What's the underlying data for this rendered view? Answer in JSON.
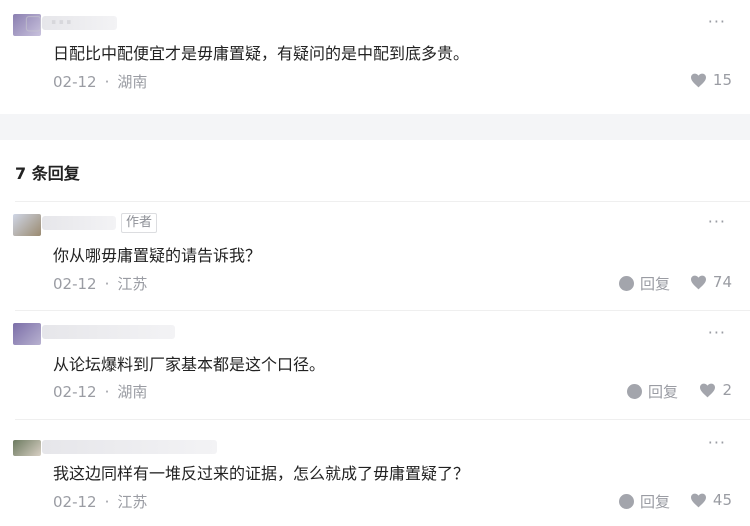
{
  "top_comment": {
    "text": "日配比中配便宜才是毋庸置疑，有疑问的是中配到底多贵。",
    "date": "02-12",
    "location": "湖南",
    "likes": "15"
  },
  "section_title": "7 条回复",
  "replies": [
    {
      "author_tag": "作者",
      "text": "你从哪毋庸置疑的请告诉我？",
      "date": "02-12",
      "location": "江苏",
      "reply_label": "回复",
      "likes": "74"
    },
    {
      "text": "从论坛爆料到厂家基本都是这个口径。",
      "date": "02-12",
      "location": "湖南",
      "reply_label": "回复",
      "likes": "2"
    },
    {
      "text": "我这边同样有一堆反过来的证据，怎么就成了毋庸置疑了？",
      "date": "02-12",
      "location": "江苏",
      "reply_label": "回复",
      "likes": "45"
    }
  ],
  "more_glyph": "···",
  "colors": {
    "meta_gray": "#9a9ca3",
    "icon_gray": "#a3a5ac",
    "band": "#f4f5f7"
  },
  "icons": [
    "more-icon",
    "reply-bubble-icon",
    "heart-icon"
  ]
}
